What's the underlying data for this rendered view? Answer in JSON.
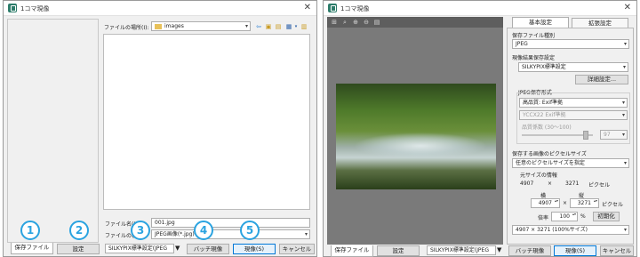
{
  "left": {
    "window_title": "1コマ現像",
    "location_label": "ファイルの場所(I):",
    "location_value": "images",
    "filename_label": "ファイル名(N):",
    "filename_value": "001.jpg",
    "filetype_label": "ファイルの種類",
    "filetype_value": "JPEG画像(*.jpg)",
    "tab_save_file": "保存ファイル",
    "btn_settings": "設定",
    "preset_value": "SILKYPIX標準設定(JPEG",
    "btn_batch": "バッチ現像",
    "btn_develop": "現像(S)",
    "btn_cancel": "キャンセル"
  },
  "callouts": [
    "1",
    "2",
    "3",
    "4",
    "5"
  ],
  "right": {
    "window_title": "1コマ現像",
    "tab_basic": "基本設定",
    "tab_extended": "拡張設定",
    "save_type_label": "保存ファイル種別",
    "save_type_value": "JPEG",
    "dev_result_label": "現像結果保存設定",
    "dev_result_value": "SILKYPIX標準設定",
    "detail_btn": "詳細設定...",
    "jpeg_format_label": "JPEG保存形式",
    "jpeg_quality_value": "高品質: Exif準拠",
    "ycc_value": "YCCX22 Exif準拠",
    "compress_label": "品質係数 (30～100)",
    "compress_value": "97",
    "pixel_size_label": "保存する画像のピクセルサイズ",
    "pixel_size_mode": "任意のピクセルサイズを指定",
    "orig_size_label": "元サイズの情報",
    "orig_w": "4907",
    "times": "×",
    "orig_h": "3271",
    "pixel_unit": "ピクセル",
    "width_label": "横",
    "height_label": "縦",
    "width_value": "4907",
    "height_value": "3271",
    "ratio_label": "倍率",
    "ratio_value": "100",
    "percent": "%",
    "reset_btn": "初期化",
    "size_summary": "4907 × 3271 (100%サイズ)",
    "tab_save_file": "保存ファイル",
    "btn_settings": "設定",
    "preset_value": "SILKYPIX標準設定(JPEG",
    "btn_batch": "バッチ現像",
    "btn_develop": "現像(S)",
    "btn_cancel": "キャンセル"
  },
  "colors": {
    "accent": "#2aa3e0",
    "primary_border": "#0078d7",
    "app_icon": "#2e7d6b"
  },
  "icons": [
    "app-icon",
    "close-icon",
    "folder-icon",
    "back-icon",
    "up-folder-icon",
    "new-folder-icon",
    "view-menu-icon",
    "grid-icon",
    "zoom-fit-icon",
    "zoom-in-icon",
    "zoom-out-icon",
    "info-icon"
  ]
}
